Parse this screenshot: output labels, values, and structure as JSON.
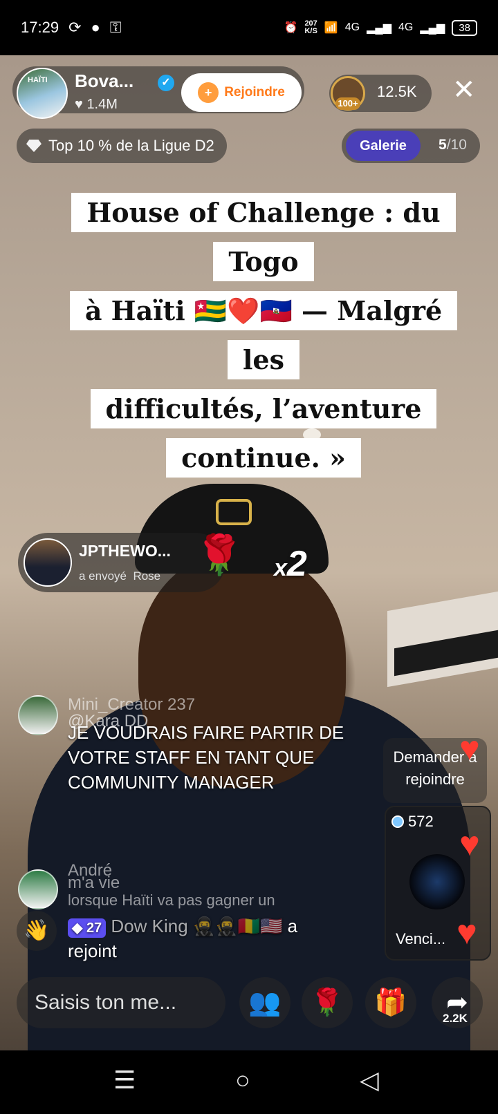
{
  "status_bar": {
    "time": "17:29",
    "net_speed_value": "207",
    "net_speed_unit": "K/S",
    "network_1": "4G",
    "network_2": "4G",
    "battery": "38"
  },
  "header": {
    "host_name": "Bova...",
    "host_likes": "1.4M",
    "join_label": "Rejoindre",
    "viewer_badge": "100+",
    "viewer_count": "12.5K",
    "close_symbol": "✕",
    "league_text": "Top 10 % de la Ligue D2",
    "gallery_label": "Galerie",
    "gallery_current": "5",
    "gallery_total": "/10"
  },
  "title_lines": [
    "House of Challenge : du Togo",
    "à Haïti 🇹🇬❤️🇭🇹 — Malgré les",
    "difficultés, l’aventure",
    "continue. »"
  ],
  "gift": {
    "sender": "JPTHEWO...",
    "sent_text": "a envoyé",
    "gift_name": "Rose",
    "combo_prefix": "x",
    "combo_count": "2"
  },
  "comments": [
    {
      "faded_top": "Mini_Creator 237",
      "mention": "@Kara DD",
      "text": "JE VOUDRAIS FAIRE PARTIR DE VOTRE STAFF EN TANT QUE COMMUNITY MANAGER"
    },
    {
      "user": "André",
      "line1": "m'a vie",
      "line2": "lorsque Haïti va pas gagner un"
    }
  ],
  "joined": {
    "level": "27",
    "name": "Dow King 🥷🥷🇬🇳🇺🇸",
    "action": "a",
    "action2": "rejoint"
  },
  "right_panel": {
    "request_line1": "Demander à",
    "request_line2": "rejoindre",
    "mini_count": "572",
    "mini_name": "Venci..."
  },
  "bottom": {
    "input_placeholder": "Saisis ton me...",
    "share_count": "2.2K"
  },
  "colors": {
    "join_orange": "#ff7a1a",
    "gallery_purple": "#4a3fb8",
    "heart_red": "#ff3b30",
    "level_badge": "#5b4ef0"
  }
}
